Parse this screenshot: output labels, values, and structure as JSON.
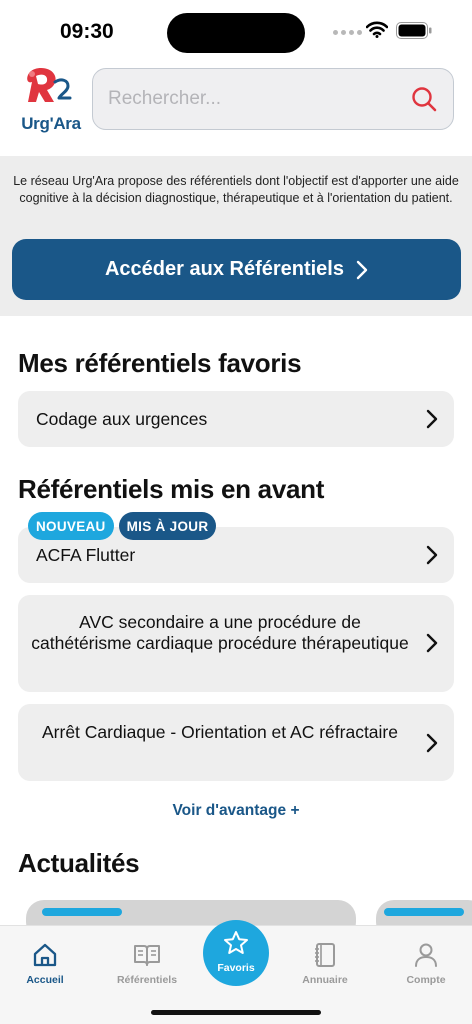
{
  "status_bar": {
    "time": "09:30"
  },
  "header": {
    "logo_text": "Urg'Ara",
    "search": {
      "placeholder": "Rechercher..."
    }
  },
  "intro": {
    "text": "Le réseau Urg'Ara propose des référentiels dont l'objectif est d'apporter une aide cognitive à la décision diagnostique, thérapeutique et à l'orientation du patient.",
    "cta_label": "Accéder aux Référentiels"
  },
  "favorites": {
    "title": "Mes référentiels favoris",
    "items": [
      {
        "label": "Codage aux urgences"
      }
    ]
  },
  "featured": {
    "title": "Référentiels mis en avant",
    "badges": [
      "NOUVEAU",
      "MIS À JOUR"
    ],
    "items": [
      {
        "label": "ACFA Flutter"
      },
      {
        "label": "AVC secondaire a une procédure de cathétérisme cardiaque procédure thérapeutique"
      },
      {
        "label": "Arrêt Cardiaque - Orientation et AC réfractaire"
      }
    ],
    "see_more": "Voir d'avantage +"
  },
  "news": {
    "title": "Actualités"
  },
  "tabbar": {
    "tabs": [
      {
        "label": "Accueil",
        "icon": "home-icon"
      },
      {
        "label": "Référentiels",
        "icon": "book-icon"
      },
      {
        "label": "Favoris",
        "icon": "star-icon"
      },
      {
        "label": "Annuaire",
        "icon": "notebook-icon"
      },
      {
        "label": "Compte",
        "icon": "user-icon"
      }
    ]
  },
  "colors": {
    "primary": "#1a5788",
    "accent": "#1ea7de",
    "logo_red": "#e0353f"
  }
}
